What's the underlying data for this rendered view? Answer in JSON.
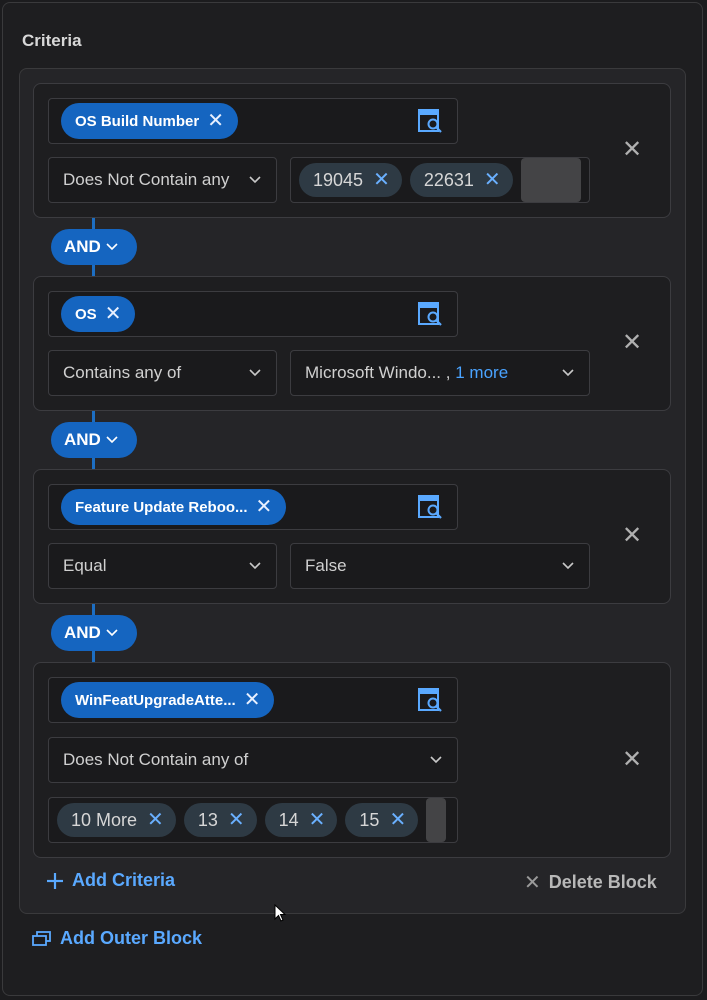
{
  "panel": {
    "title": "Criteria"
  },
  "criteria": [
    {
      "field": "OS Build Number",
      "operator": "Does Not Contain any",
      "values": [
        "19045",
        "22631"
      ]
    },
    {
      "field": "OS",
      "operator": "Contains any of",
      "value_text": "Microsoft Windo...",
      "separator": ",",
      "more_text": "1 more"
    },
    {
      "field": "Feature Update Reboo...",
      "operator": "Equal",
      "value_text": "False"
    },
    {
      "field": "WinFeatUpgradeAtte...",
      "operator": "Does Not Contain any of",
      "values": [
        "10 More",
        "13",
        "14",
        "15"
      ]
    }
  ],
  "connectors": [
    "AND",
    "AND",
    "AND"
  ],
  "footer": {
    "add_criteria": "Add Criteria",
    "delete_block": "Delete Block",
    "add_outer_block": "Add Outer Block"
  },
  "icons": {
    "remove": "close-icon",
    "lookup": "field-lookup-icon",
    "dropdown": "chevron-down-icon",
    "add": "plus-icon",
    "outer": "add-block-icon"
  },
  "colors": {
    "accent": "#1565c0",
    "link": "#5aa9ff",
    "background": "#1c1c1e"
  }
}
